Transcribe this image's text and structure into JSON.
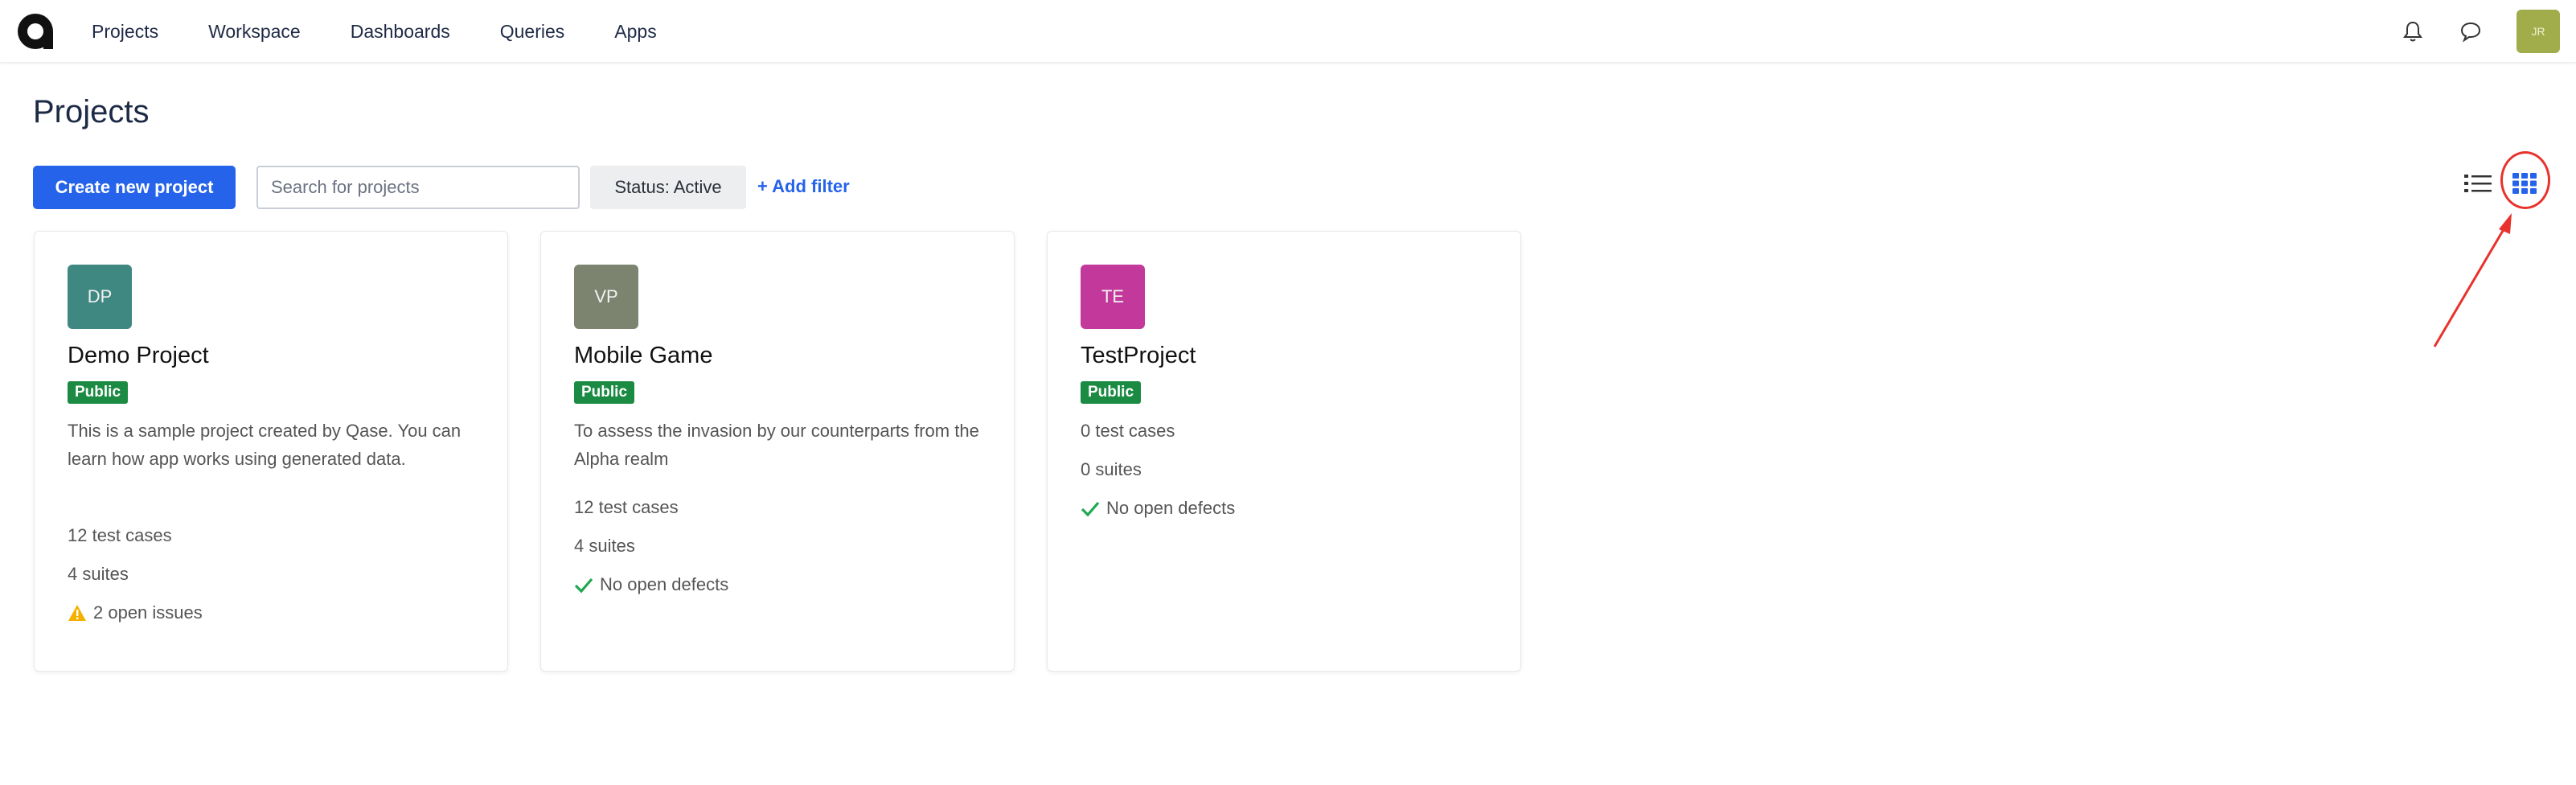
{
  "nav": {
    "items": [
      "Projects",
      "Workspace",
      "Dashboards",
      "Queries",
      "Apps"
    ]
  },
  "user": {
    "initials": "JR",
    "avatar_color": "#a0ad4a"
  },
  "page": {
    "title": "Projects"
  },
  "toolbar": {
    "create_label": "Create new project",
    "search_placeholder": "Search for projects",
    "status_filter": "Status: Active",
    "add_filter": "+ Add filter"
  },
  "colors": {
    "accent": "#2563eb",
    "public_badge": "#1b8a42",
    "annotation": "#e8322b"
  },
  "projects": [
    {
      "initials": "DP",
      "avatar_color": "#3f8781",
      "name": "Demo Project",
      "visibility": "Public",
      "description": "This is a sample project created by Qase. You can learn how app works using generated data.",
      "test_cases": "12 test cases",
      "suites": "4 suites",
      "defects": "2 open issues",
      "defects_icon": "warning-icon"
    },
    {
      "initials": "VP",
      "avatar_color": "#7c8470",
      "name": "Mobile Game",
      "visibility": "Public",
      "description": "To assess the invasion by our counterparts from the Alpha realm",
      "test_cases": "12 test cases",
      "suites": "4 suites",
      "defects": "No open defects",
      "defects_icon": "check-icon"
    },
    {
      "initials": "TE",
      "avatar_color": "#c2399b",
      "name": "TestProject",
      "visibility": "Public",
      "description": "",
      "test_cases": "0 test cases",
      "suites": "0 suites",
      "defects": "No open defects",
      "defects_icon": "check-icon"
    }
  ]
}
